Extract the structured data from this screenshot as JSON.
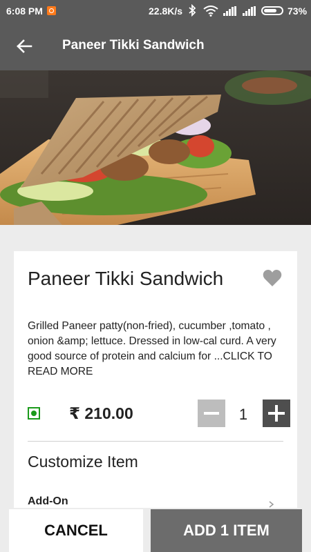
{
  "status_bar": {
    "time": "6:08 PM",
    "net_speed": "22.8K/s",
    "battery_percent_text": "73%",
    "battery_level": 0.73,
    "icons": [
      "notification-icon",
      "bluetooth-icon",
      "wifi-icon",
      "signal-icon",
      "signal-icon",
      "battery-icon"
    ]
  },
  "app_bar": {
    "title": "Paneer Tikki Sandwich",
    "back_icon": "back-arrow-icon"
  },
  "hero": {
    "image": "sandwich-photo"
  },
  "item": {
    "name": "Paneer Tikki Sandwich",
    "favorite_icon": "heart-icon",
    "description": "Grilled Paneer patty(non-fried), cucumber ,tomato , onion &amp; lettuce. Dressed in low-cal curd. A very good source of protein and calcium for ...",
    "read_more": "CLICK TO READ MORE",
    "veg_icon": "veg-mark-icon",
    "price": "₹ 210.00",
    "quantity": "1"
  },
  "customize": {
    "heading": "Customize Item",
    "addon_label": "Add-On"
  },
  "actions": {
    "cancel": "CANCEL",
    "add": "ADD 1 ITEM"
  },
  "colors": {
    "app_bar": "#5a5a5a",
    "veg_green": "#1a9a1a",
    "minus_button": "#bdbdbd",
    "plus_button": "#4e4e4e",
    "add_button": "#6c6c6c"
  }
}
